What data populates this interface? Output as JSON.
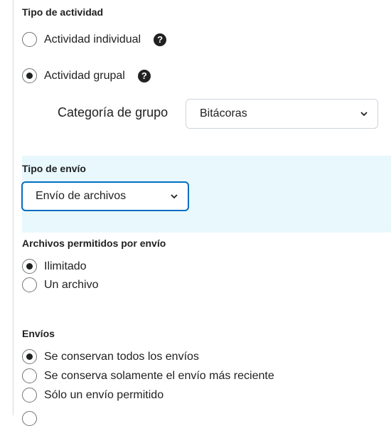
{
  "activity_type": {
    "heading": "Tipo de actividad",
    "options": [
      {
        "label": "Actividad individual",
        "selected": false,
        "help_icon": "question-circle-icon"
      },
      {
        "label": "Actividad grupal",
        "selected": true,
        "help_icon": "question-circle-icon"
      }
    ],
    "group_category": {
      "label": "Categoría de grupo",
      "value": "Bitácoras"
    }
  },
  "submission_type": {
    "heading": "Tipo de envío",
    "value": "Envío de archivos",
    "highlight_color": "#e8f8fd",
    "focus_color": "#006fbf"
  },
  "files_per_submission": {
    "heading": "Archivos permitidos por envío",
    "options": [
      {
        "label": "Ilimitado",
        "selected": true
      },
      {
        "label": "Un archivo",
        "selected": false
      }
    ]
  },
  "submissions": {
    "heading": "Envíos",
    "options": [
      {
        "label": "Se conservan todos los envíos",
        "selected": true
      },
      {
        "label": "Se conserva solamente el envío más reciente",
        "selected": false
      },
      {
        "label": "Sólo un envío permitido",
        "selected": false
      }
    ]
  }
}
